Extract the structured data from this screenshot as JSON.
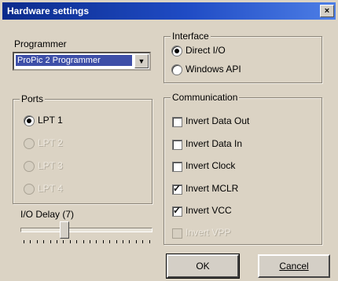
{
  "window": {
    "title": "Hardware settings",
    "close_glyph": "×"
  },
  "programmer": {
    "label": "Programmer",
    "selected": "ProPic 2 Programmer",
    "arrow": "▼"
  },
  "interface": {
    "legend": "Interface",
    "options": [
      {
        "label": "Direct I/O",
        "checked": true
      },
      {
        "label": "Windows API",
        "checked": false
      }
    ]
  },
  "ports": {
    "legend": "Ports",
    "options": [
      {
        "label": "LPT 1",
        "checked": true,
        "enabled": true
      },
      {
        "label": "LPT 2",
        "checked": false,
        "enabled": false
      },
      {
        "label": "LPT 3",
        "checked": false,
        "enabled": false
      },
      {
        "label": "LPT 4",
        "checked": false,
        "enabled": false
      }
    ]
  },
  "communication": {
    "legend": "Communication",
    "options": [
      {
        "label": "Invert Data Out",
        "checked": false,
        "enabled": true
      },
      {
        "label": "Invert Data In",
        "checked": false,
        "enabled": true
      },
      {
        "label": "Invert Clock",
        "checked": false,
        "enabled": true
      },
      {
        "label": "Invert MCLR",
        "checked": true,
        "enabled": true
      },
      {
        "label": "Invert VCC",
        "checked": true,
        "enabled": true
      },
      {
        "label": "Invert VPP",
        "checked": false,
        "enabled": false
      }
    ]
  },
  "io_delay": {
    "label": "I/O Delay (7)",
    "value": 7
  },
  "buttons": {
    "ok": "OK",
    "cancel": "Cancel"
  },
  "check_glyph": "✓"
}
